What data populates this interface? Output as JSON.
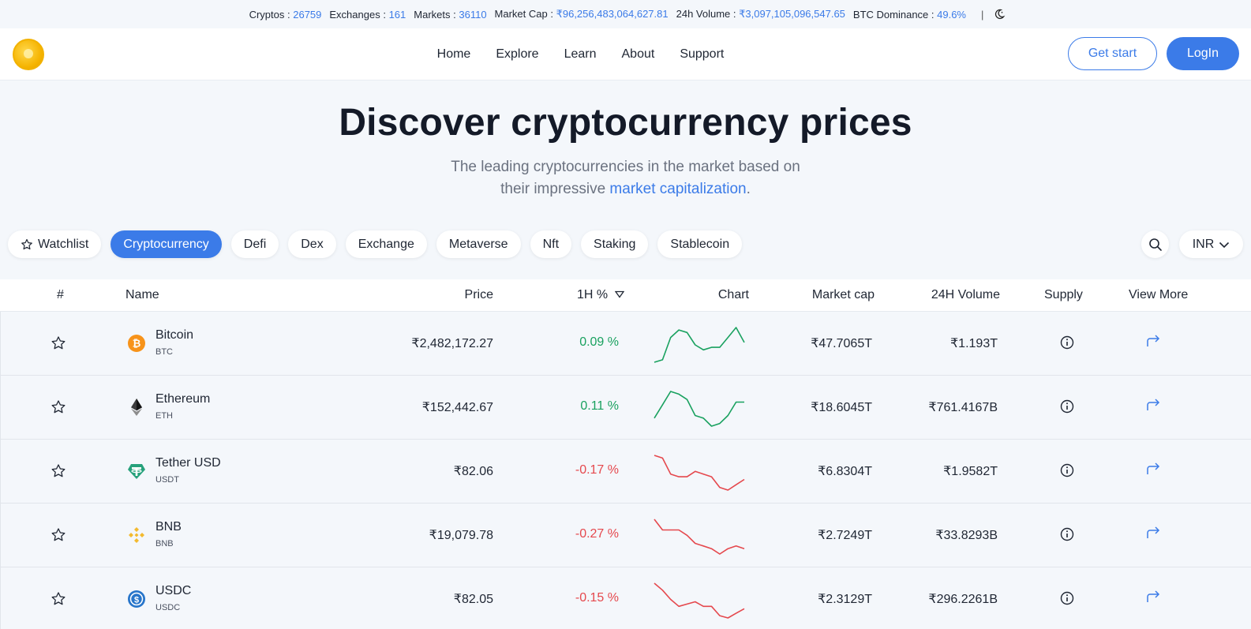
{
  "stats": {
    "cryptos_label": "Cryptos :",
    "cryptos_value": "26759",
    "exchanges_label": "Exchanges :",
    "exchanges_value": "161",
    "markets_label": "Markets :",
    "markets_value": "36110",
    "marketcap_label": "Market Cap :",
    "marketcap_value": "₹96,256,483,064,627.81",
    "volume_label": "24h Volume :",
    "volume_value": "₹3,097,105,096,547.65",
    "dominance_label": "BTC Dominance :",
    "dominance_value": "49.6%",
    "separator": "|",
    "theme_icon": "moon-icon"
  },
  "nav": {
    "items": [
      "Home",
      "Explore",
      "Learn",
      "About",
      "Support"
    ],
    "get_start": "Get start",
    "login": "LogIn"
  },
  "hero": {
    "title": "Discover cryptocurrency prices",
    "subtitle_line1": "The leading cryptocurrencies in the market based on",
    "subtitle_line2_prefix": "their impressive ",
    "subtitle_link": "market capitalization",
    "subtitle_suffix": "."
  },
  "filters": {
    "chips": [
      "Watchlist",
      "Cryptocurrency",
      "Defi",
      "Dex",
      "Exchange",
      "Metaverse",
      "Nft",
      "Staking",
      "Stablecoin"
    ],
    "active": "Cryptocurrency",
    "currency": "INR"
  },
  "table": {
    "headers": {
      "rank": "#",
      "name": "Name",
      "price": "Price",
      "change": "1H %",
      "chart": "Chart",
      "mcap": "Market cap",
      "volume": "24H Volume",
      "supply": "Supply",
      "more": "View More"
    },
    "rows": [
      {
        "name": "Bitcoin",
        "symbol": "BTC",
        "price": "₹2,482,172.27",
        "change": "0.09 %",
        "trend": "up",
        "mcap": "₹47.7065T",
        "volume": "₹1.193T",
        "icon_color": "#f7931a",
        "spark": [
          2,
          3,
          12,
          15,
          14,
          9,
          7,
          8,
          8,
          12,
          16,
          10
        ]
      },
      {
        "name": "Ethereum",
        "symbol": "ETH",
        "price": "₹152,442.67",
        "change": "0.11 %",
        "trend": "up",
        "mcap": "₹18.6045T",
        "volume": "₹761.4167B",
        "icon_color": "#3c3c3d",
        "spark": [
          4,
          9,
          14,
          13,
          11,
          5,
          4,
          1,
          2,
          5,
          10,
          10
        ]
      },
      {
        "name": "Tether USD",
        "symbol": "USDT",
        "price": "₹82.06",
        "change": "-0.17 %",
        "trend": "down",
        "mcap": "₹6.8304T",
        "volume": "₹1.9582T",
        "icon_color": "#26a17b",
        "spark": [
          16,
          15,
          9,
          8,
          8,
          10,
          9,
          8,
          4,
          3,
          5,
          7
        ]
      },
      {
        "name": "BNB",
        "symbol": "BNB",
        "price": "₹19,079.78",
        "change": "-0.27 %",
        "trend": "down",
        "mcap": "₹2.7249T",
        "volume": "₹33.8293B",
        "icon_color": "#f3ba2f",
        "spark": [
          16,
          12,
          12,
          12,
          10,
          7,
          6,
          5,
          3,
          5,
          6,
          5
        ]
      },
      {
        "name": "USDC",
        "symbol": "USDC",
        "price": "₹82.05",
        "change": "-0.15 %",
        "trend": "down",
        "mcap": "₹2.3129T",
        "volume": "₹296.2261B",
        "icon_color": "#2775ca",
        "spark": [
          16,
          13,
          9,
          6,
          7,
          8,
          6,
          6,
          2,
          1,
          3,
          5
        ]
      }
    ]
  },
  "colors": {
    "accent": "#3b7be8",
    "positive": "#19a15f",
    "negative": "#e5484d"
  }
}
